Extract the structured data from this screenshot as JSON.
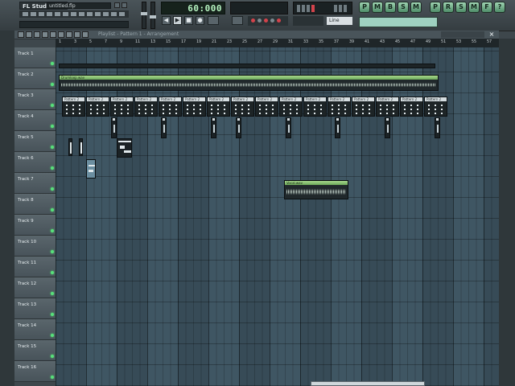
{
  "app": {
    "logo_text": "FL Studio",
    "project_title": "untitled.flp",
    "time_display": "60:000",
    "line_mode": "Line",
    "accent_color": "#7fc79a",
    "grid_color": "#3f5663"
  },
  "transport": {
    "prev_label": "◀",
    "stop_label": "■",
    "play_label": "▶",
    "record_label": "●"
  },
  "tool_icons": [
    "P",
    "M",
    "B",
    "S",
    "M"
  ],
  "tool_icons_right": [
    "P",
    "R",
    "S",
    "M",
    "F",
    "?"
  ],
  "playlist": {
    "title": "Playlist - Pattern 1 - Arrangement",
    "close_label": "×",
    "bar_numbers": [
      "1",
      "3",
      "5",
      "7",
      "9",
      "11",
      "13",
      "15",
      "17",
      "19",
      "21",
      "23",
      "25",
      "27",
      "29",
      "31",
      "33",
      "35",
      "37",
      "39",
      "41",
      "43",
      "45",
      "47",
      "49",
      "51",
      "53",
      "55",
      "57"
    ]
  },
  "tracks": [
    {
      "label": "Track 1"
    },
    {
      "label": "Track 2"
    },
    {
      "label": "Track 3"
    },
    {
      "label": "Track 4"
    },
    {
      "label": "Track 5"
    },
    {
      "label": "Track 6"
    },
    {
      "label": "Track 7"
    },
    {
      "label": "Track 8"
    },
    {
      "label": "Track 9"
    },
    {
      "label": "Track 10"
    },
    {
      "label": "Track 11"
    },
    {
      "label": "Track 12"
    },
    {
      "label": "Track 13"
    },
    {
      "label": "Track 14"
    },
    {
      "label": "Track 15"
    },
    {
      "label": "Track 16"
    }
  ],
  "clips": {
    "track2_audio": "Drumloop.wav",
    "track7_audio": "Vocal.wav",
    "pattern_name": "Pattern 2"
  }
}
